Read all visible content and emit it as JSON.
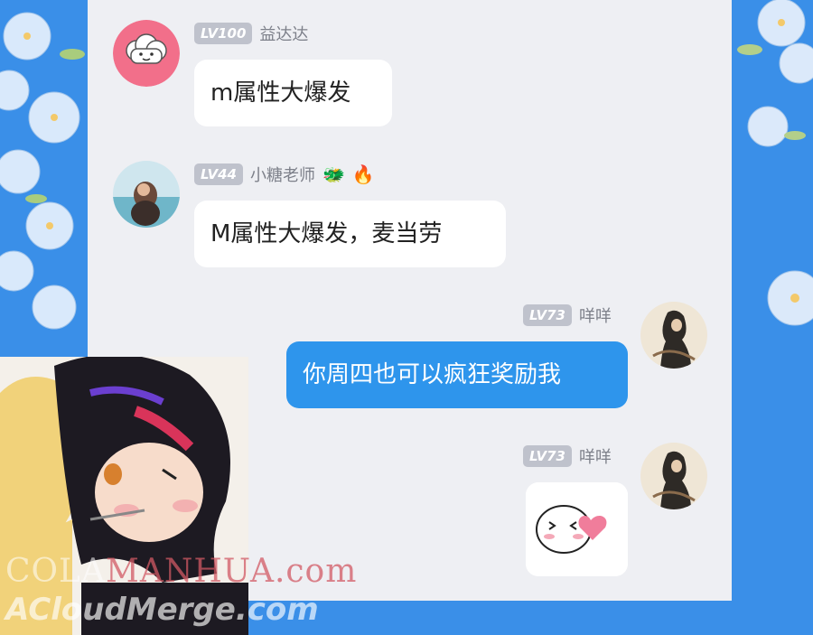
{
  "messages": [
    {
      "level": "LV100",
      "name": "益达达",
      "text": "m属性大爆发",
      "side": "left",
      "avatar": "cloud-avatar-icon"
    },
    {
      "level": "LV44",
      "name": "小糖老师",
      "badges": [
        "🐲",
        "🔥"
      ],
      "text": "M属性大爆发，麦当劳",
      "side": "left",
      "avatar": "beach-photo-avatar"
    },
    {
      "level": "LV73",
      "name": "咩咩",
      "text": "你周四也可以疯狂奖励我",
      "side": "right",
      "avatar": "ink-painting-avatar"
    },
    {
      "level": "LV73",
      "name": "咩咩",
      "sticker": "blushing-heart-sticker",
      "side": "right",
      "avatar": "ink-painting-avatar"
    }
  ],
  "watermark": {
    "line1_prefix": "COLA",
    "line1_accent": "MANHUA.com",
    "line2": "ACloudMerge.com"
  },
  "colors": {
    "background": "#3a8fe8",
    "chat_bg": "#eeeff3",
    "bubble_blue": "#2e95ec",
    "level_badge": "#bfc2cc"
  }
}
